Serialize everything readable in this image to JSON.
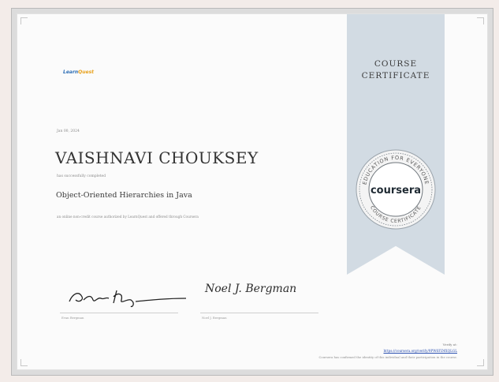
{
  "logo": {
    "part1": "Learn",
    "part2": "Quest"
  },
  "ribbon": {
    "title_line1": "COURSE",
    "title_line2": "CERTIFICATE"
  },
  "seal": {
    "center_text": "coursera",
    "ring_text_top": "EDUCATION FOR EVERYONE",
    "ring_text_bottom": "COURSE CERTIFICATE"
  },
  "certificate": {
    "date": "Jan 00, 2024",
    "recipient": "VAISHNAVI CHOUKSEY",
    "completed_text": "has successfully completed",
    "course_title": "Object-Oriented Hierarchies in Java",
    "description": "an online non-credit course authorized by LearnQuest and offered through Coursera"
  },
  "signatures": {
    "sig2_text": "Noel J. Bergman",
    "sig1_caption": "Evan Bergman",
    "sig2_caption": "Noel J. Bergman"
  },
  "verify": {
    "label": "Verify at:",
    "link": "https://coursera.org/verify/9PW6FZ4XQLGL",
    "note": "Coursera has confirmed the identity of this individual and their participation in the course."
  },
  "colors": {
    "ribbon": "#d2dbe3",
    "link": "#2a4fb0",
    "logo_blue": "#2f6fb6",
    "logo_orange": "#e8a11c"
  }
}
